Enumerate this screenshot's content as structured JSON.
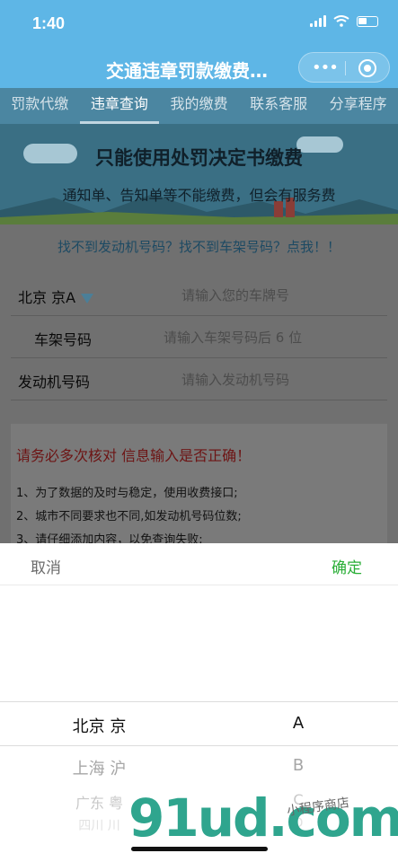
{
  "status_bar": {
    "time": "1:40"
  },
  "nav": {
    "title": "交通违章罚款缴费…",
    "more_label": "•••"
  },
  "tabs": [
    {
      "label": "罚款代缴",
      "active": false
    },
    {
      "label": "违章查询",
      "active": true
    },
    {
      "label": "我的缴费",
      "active": false
    },
    {
      "label": "联系客服",
      "active": false
    },
    {
      "label": "分享程序",
      "active": false
    }
  ],
  "banner": {
    "line1": "只能使用处罚决定书缴费",
    "line2": "通知单、告知单等不能缴费，但会有服务费"
  },
  "form": {
    "help_link": "找不到发动机号码？找不到车架号码？点我！！",
    "plate": {
      "region": "北京 京A",
      "placeholder": "请输入您的车牌号"
    },
    "frame": {
      "label": "车架号码",
      "placeholder": "请输入车架号码后 6 位"
    },
    "engine": {
      "label": "发动机号码",
      "placeholder": "请输入发动机号码"
    }
  },
  "notice": {
    "title": "请务必多次核对 信息输入是否正确！",
    "items": [
      "1、为了数据的及时与稳定，使用收费接口;",
      "2、城市不同要求也不同,如发动机号码位数;",
      "3、请仔细添加内容，以免查询失败;"
    ]
  },
  "picker": {
    "cancel": "取消",
    "confirm": "确定",
    "provinces": [
      "北京 京",
      "上海 沪",
      "广东 粤",
      "四川 川"
    ],
    "letters": [
      "A",
      "B",
      "C",
      "D"
    ],
    "selected_province": "北京 京",
    "selected_letter": "A"
  },
  "watermark": {
    "main": "91ud.com",
    "sub": "小程序商店"
  },
  "colors": {
    "nav": "#5eb6e6",
    "confirm": "#2aae37",
    "notice_title": "#6d1414"
  }
}
